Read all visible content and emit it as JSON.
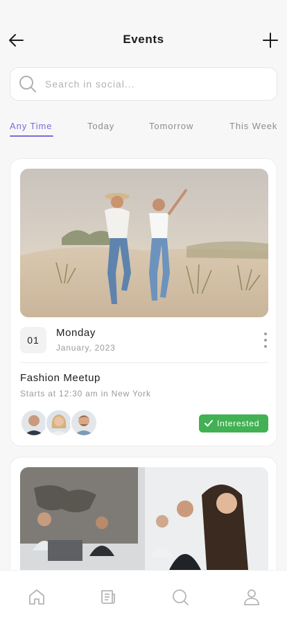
{
  "header": {
    "title": "Events"
  },
  "search": {
    "placeholder": "Search in social..."
  },
  "tabs": [
    {
      "label": "Any Time"
    },
    {
      "label": "Today"
    },
    {
      "label": "Tomorrow"
    },
    {
      "label": "This Week"
    }
  ],
  "active_tab": "Any Time",
  "events": [
    {
      "day_num": "01",
      "weekday": "Monday",
      "month_year": "January, 2023",
      "name": "Fashion Meetup",
      "details": "Starts at 12:30 am in New York",
      "status": "Interested"
    }
  ],
  "colors": {
    "accent": "#7e6ad8",
    "interested": "#41b153"
  },
  "icons": {
    "back": "arrow-left-icon",
    "add": "plus-icon",
    "search": "search-icon",
    "more": "more-vertical-icon",
    "check": "check-icon",
    "nav": [
      "home-icon",
      "newspaper-icon",
      "search-icon",
      "user-icon"
    ]
  }
}
